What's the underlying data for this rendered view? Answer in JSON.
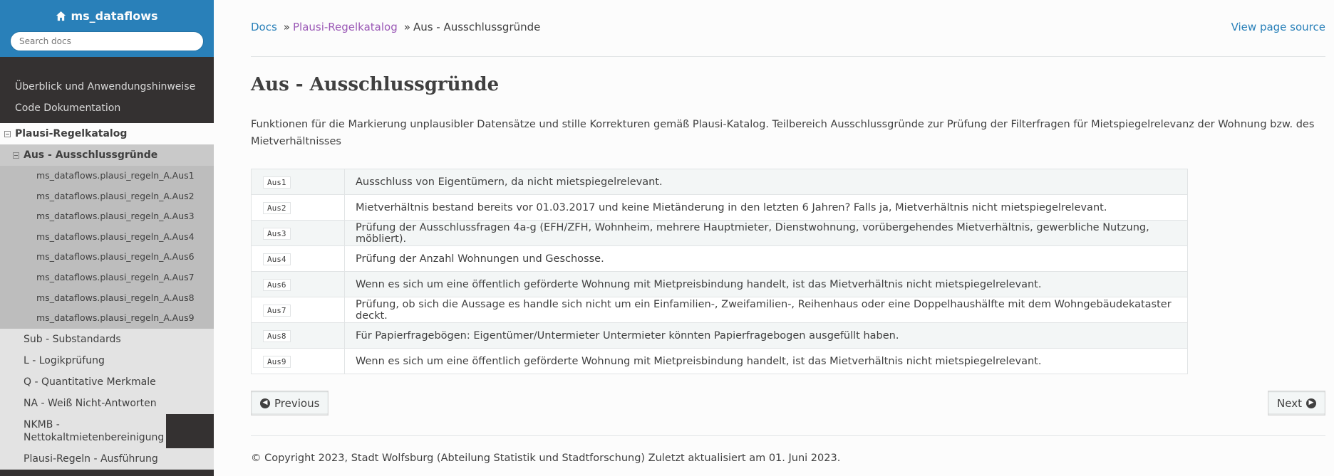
{
  "sidebar": {
    "project": "ms_dataflows",
    "search_placeholder": "Search docs",
    "top_items": [
      "Überblick und Anwendungshinweise",
      "Code Dokumentation"
    ],
    "current": "Plausi-Regelkatalog",
    "current_sub": "Aus - Ausschlussgründe",
    "modules": [
      "ms_dataflows.plausi_regeln_A.Aus1",
      "ms_dataflows.plausi_regeln_A.Aus2",
      "ms_dataflows.plausi_regeln_A.Aus3",
      "ms_dataflows.plausi_regeln_A.Aus4",
      "ms_dataflows.plausi_regeln_A.Aus6",
      "ms_dataflows.plausi_regeln_A.Aus7",
      "ms_dataflows.plausi_regeln_A.Aus8",
      "ms_dataflows.plausi_regeln_A.Aus9"
    ],
    "other_sections": [
      "Sub - Substandards",
      "L - Logikprüfung",
      "Q - Quantitative Merkmale",
      "NA - Weiß Nicht-Antworten",
      "NKMB - Nettokaltmietenbereinigung",
      "Plausi-Regeln - Ausführung"
    ]
  },
  "breadcrumbs": {
    "docs": "Docs",
    "sep": "»",
    "parent": "Plausi-Regelkatalog",
    "current": "Aus - Ausschlussgründe"
  },
  "view_source": "View page source",
  "page": {
    "title": "Aus - Ausschlussgründe",
    "description": "Funktionen für die Markierung unplausibler Datensätze und stille Korrekturen gemäß Plausi-Katalog. Teilbereich Ausschlussgründe zur Prüfung der Filterfragen für Mietspiegelrelevanz der Wohnung bzw. des Mietverhältnisses"
  },
  "table": {
    "rows": [
      {
        "code": "Aus1",
        "text": "Ausschluss von Eigentümern, da nicht mietspiegelrelevant."
      },
      {
        "code": "Aus2",
        "text": "Mietverhältnis bestand bereits vor 01.03.2017 und keine Mietänderung in den letzten 6 Jahren? Falls ja, Mietverhältnis nicht mietspiegelrelevant."
      },
      {
        "code": "Aus3",
        "text": "Prüfung der Ausschlussfragen 4a-g (EFH/ZFH, Wohnheim, mehrere Hauptmieter, Dienstwohnung, vorübergehendes Mietverhältnis, gewerbliche Nutzung, möbliert)."
      },
      {
        "code": "Aus4",
        "text": "Prüfung der Anzahl Wohnungen und Geschosse."
      },
      {
        "code": "Aus6",
        "text": "Wenn es sich um eine öffentlich geförderte Wohnung mit Mietpreisbindung handelt, ist das Mietverhältnis nicht mietspiegelrelevant."
      },
      {
        "code": "Aus7",
        "text": "Prüfung, ob sich die Aussage es handle sich nicht um ein Einfamilien-, Zweifamilien-, Reihenhaus oder eine Doppelhaushälfte mit dem Wohngebäudekataster deckt."
      },
      {
        "code": "Aus8",
        "text": "Für Papierfragebögen: Eigentümer/Untermieter Untermieter könnten Papierfragebogen ausgefüllt haben."
      },
      {
        "code": "Aus9",
        "text": "Wenn es sich um eine öffentlich geförderte Wohnung mit Mietpreisbindung handelt, ist das Mietverhältnis nicht mietspiegelrelevant."
      }
    ]
  },
  "nav": {
    "previous": "Previous",
    "next": "Next"
  },
  "footer": "© Copyright 2023, Stadt Wolfsburg (Abteilung Statistik und Stadtforschung) Zuletzt aktualisiert am 01. Juni 2023.",
  "colors": {
    "sidebar_top": "#2980b9",
    "sidebar_bg": "#343131",
    "link": "#2980b9",
    "visited_link": "#9b59b6"
  },
  "icons": {
    "brand": "home-icon",
    "prev": "circle-arrow-left-icon",
    "next": "circle-arrow-right-icon"
  }
}
